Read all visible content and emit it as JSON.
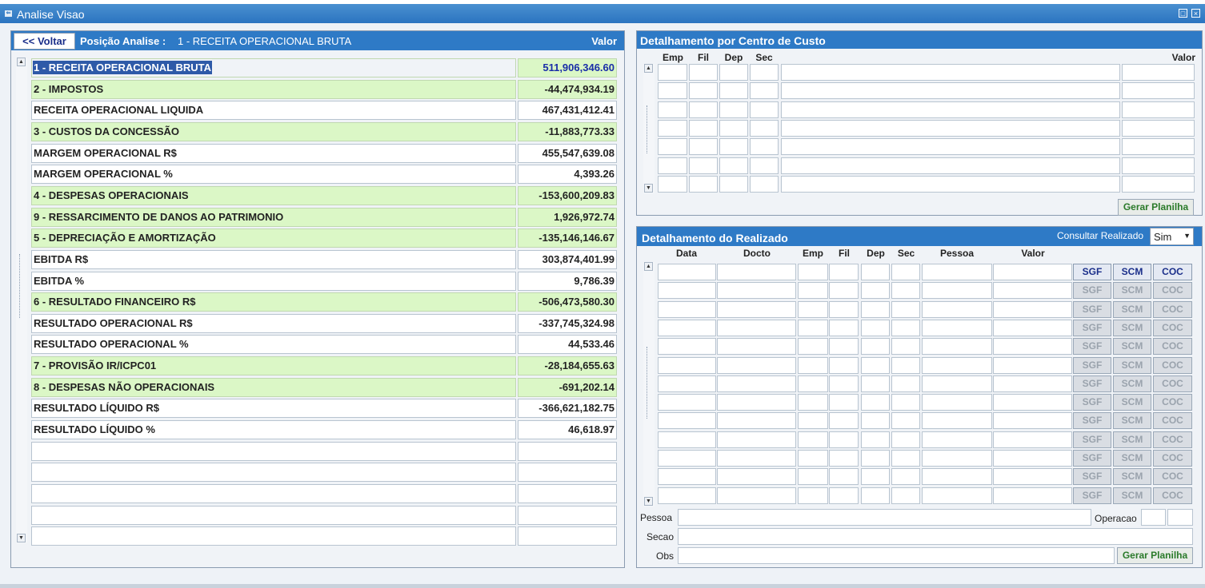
{
  "window": {
    "title": "Analise Visao"
  },
  "left": {
    "back_label": "<< Voltar",
    "posicao_label": "Posição Analise :",
    "posicao_value": "1 - RECEITA OPERACIONAL BRUTA",
    "valor_header": "Valor",
    "rows": [
      {
        "label": "1 - RECEITA OPERACIONAL BRUTA",
        "value": "511,906,346.60",
        "green": true
      },
      {
        "label": "2 - IMPOSTOS",
        "value": "-44,474,934.19",
        "green": true
      },
      {
        "label": "RECEITA OPERACIONAL LIQUIDA",
        "value": "467,431,412.41",
        "green": false
      },
      {
        "label": "3 - CUSTOS DA CONCESSÃO",
        "value": "-11,883,773.33",
        "green": true
      },
      {
        "label": "MARGEM OPERACIONAL R$",
        "value": "455,547,639.08",
        "green": false
      },
      {
        "label": "MARGEM OPERACIONAL %",
        "value": "4,393.26",
        "green": false
      },
      {
        "label": "4 - DESPESAS OPERACIONAIS",
        "value": "-153,600,209.83",
        "green": true
      },
      {
        "label": "9 - RESSARCIMENTO DE DANOS AO PATRIMONIO",
        "value": "1,926,972.74",
        "green": true
      },
      {
        "label": "5 - DEPRECIAÇÃO E AMORTIZAÇÃO",
        "value": "-135,146,146.67",
        "green": true
      },
      {
        "label": "EBITDA R$",
        "value": "303,874,401.99",
        "green": false
      },
      {
        "label": "EBITDA %",
        "value": "9,786.39",
        "green": false
      },
      {
        "label": "6 - RESULTADO FINANCEIRO R$",
        "value": "-506,473,580.30",
        "green": true
      },
      {
        "label": "RESULTADO OPERACIONAL R$",
        "value": "-337,745,324.98",
        "green": false
      },
      {
        "label": "RESULTADO OPERACIONAL %",
        "value": "44,533.46",
        "green": false
      },
      {
        "label": "7 - PROVISÃO IR/ICPC01",
        "value": "-28,184,655.63",
        "green": true
      },
      {
        "label": "8 - DESPESAS NÃO OPERACIONAIS",
        "value": "-691,202.14",
        "green": true
      },
      {
        "label": "RESULTADO LÍQUIDO R$",
        "value": "-366,621,182.75",
        "green": false
      },
      {
        "label": "RESULTADO LÍQUIDO %",
        "value": "46,618.97",
        "green": false
      },
      {
        "label": "",
        "value": "",
        "green": false
      },
      {
        "label": "",
        "value": "",
        "green": false
      },
      {
        "label": "",
        "value": "",
        "green": false
      },
      {
        "label": "",
        "value": "",
        "green": false
      },
      {
        "label": "",
        "value": "",
        "green": false
      }
    ]
  },
  "centro": {
    "title": "Detalhamento por Centro de Custo",
    "cols": {
      "emp": "Emp",
      "fil": "Fil",
      "dep": "Dep",
      "sec": "Sec",
      "valor": "Valor"
    },
    "row_count": 7,
    "gerar_label": "Gerar Planilha"
  },
  "realizado": {
    "title": "Detalhamento do Realizado",
    "consultar_label": "Consultar Realizado",
    "consultar_value": "Sim",
    "cols": {
      "data": "Data",
      "docto": "Docto",
      "emp": "Emp",
      "fil": "Fil",
      "dep": "Dep",
      "sec": "Sec",
      "pessoa": "Pessoa",
      "valor": "Valor"
    },
    "btn_sgf": "SGF",
    "btn_scm": "SCM",
    "btn_coc": "COC",
    "row_count": 13,
    "pessoa_label": "Pessoa",
    "operacao_label": "Operacao",
    "secao_label": "Secao",
    "obs_label": "Obs",
    "gerar_label": "Gerar Planilha"
  },
  "colors": {
    "title_blue": "#2e7ac6",
    "green_row": "#dbf7c6",
    "link_blue": "#1a2e8a"
  }
}
